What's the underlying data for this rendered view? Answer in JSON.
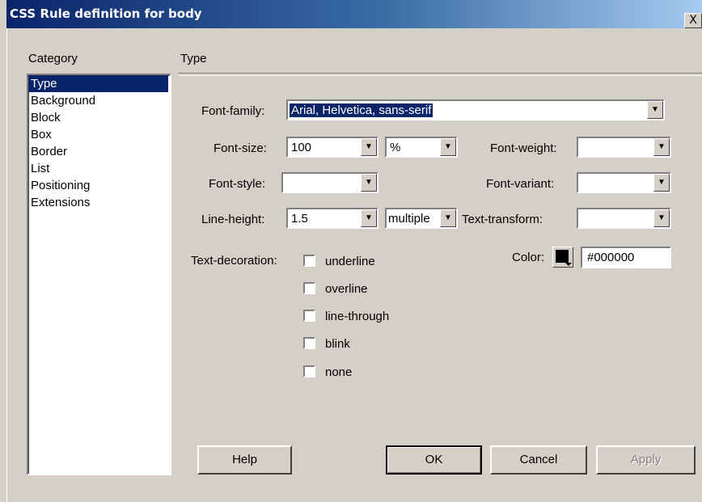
{
  "window": {
    "title": "CSS Rule definition for body",
    "close_label": "X"
  },
  "category": {
    "label": "Category",
    "items": [
      "Type",
      "Background",
      "Block",
      "Box",
      "Border",
      "List",
      "Positioning",
      "Extensions"
    ],
    "selected": "Type"
  },
  "panel": {
    "title": "Type"
  },
  "font_family": {
    "label": "Font-family:",
    "value": "Arial, Helvetica, sans-serif"
  },
  "font_size": {
    "label": "Font-size:",
    "value": "100",
    "unit": "%"
  },
  "font_weight": {
    "label": "Font-weight:",
    "value": ""
  },
  "font_style": {
    "label": "Font-style:",
    "value": ""
  },
  "font_variant": {
    "label": "Font-variant:",
    "value": ""
  },
  "line_height": {
    "label": "Line-height:",
    "value": "1.5",
    "unit": "multiple"
  },
  "text_transform": {
    "label": "Text-transform:",
    "value": ""
  },
  "text_decoration": {
    "label": "Text-decoration:",
    "options": [
      {
        "label": "underline",
        "checked": false
      },
      {
        "label": "overline",
        "checked": false
      },
      {
        "label": "line-through",
        "checked": false
      },
      {
        "label": "blink",
        "checked": false
      },
      {
        "label": "none",
        "checked": false
      }
    ]
  },
  "color": {
    "label": "Color:",
    "value": "#000000",
    "swatch": "#000000"
  },
  "buttons": {
    "help": "Help",
    "ok": "OK",
    "cancel": "Cancel",
    "apply": "Apply"
  },
  "icons": {
    "dropdown": "dropdown-arrow-icon",
    "close": "close-icon",
    "color_picker": "color-picker-icon"
  }
}
